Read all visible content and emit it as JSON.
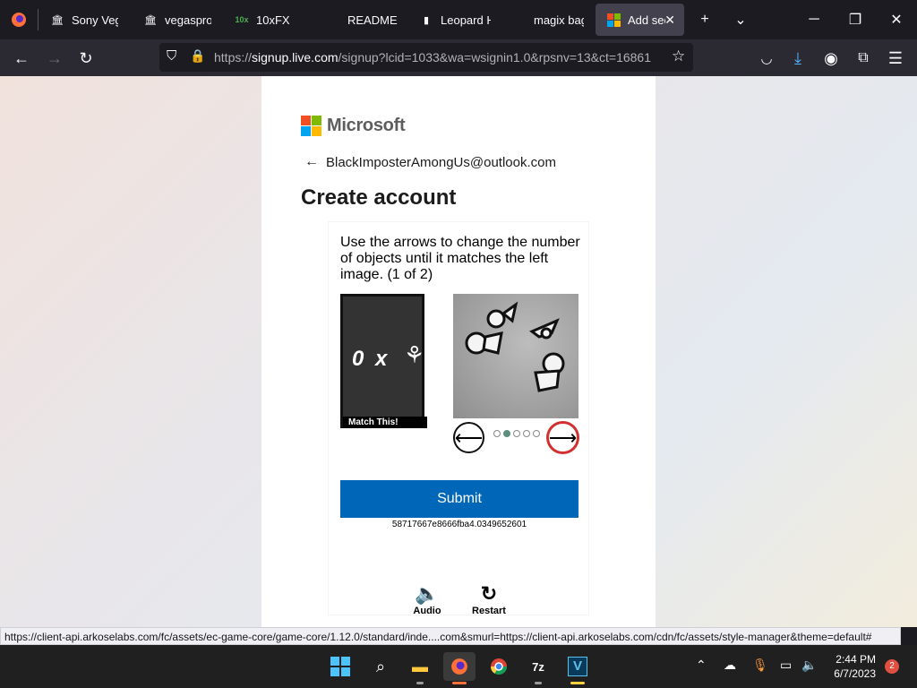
{
  "browser": {
    "tabs": [
      {
        "label": "Sony Vegas",
        "icon": "museum-icon"
      },
      {
        "label": "vegasprova",
        "icon": "museum-icon"
      },
      {
        "label": "10xFX",
        "icon": "fx-icon"
      },
      {
        "label": "README.pdf",
        "icon": "pdf-icon"
      },
      {
        "label": "Leopard H",
        "icon": "bookmark-icon"
      },
      {
        "label": "magix bagix.m",
        "icon": "page-icon"
      },
      {
        "label": "Add sec",
        "icon": "microsoft-icon",
        "active": true
      }
    ],
    "url_domain": "signup.live.com",
    "url_prefix": "https://",
    "url_rest": "/signup?lcid=1033&wa=wsignin1.0&rpsnv=13&ct=16861"
  },
  "page": {
    "brand": "Microsoft",
    "identity": "BlackImposterAmongUs@outlook.com",
    "title": "Create account",
    "challenge": {
      "instruction": "Use the arrows to change the number of objects until it matches the left image. (1 of 2)",
      "target_count": "0 x",
      "match_label": "Match This!",
      "prev_label": "⟵",
      "next_label": "⟶",
      "dots_total": 5,
      "dots_selected": 2,
      "submit_label": "Submit",
      "session_id": "58717667e8666fba4.0349652601",
      "audio_label": "Audio",
      "restart_label": "Restart"
    }
  },
  "status_url": "https://client-api.arkoselabs.com/fc/assets/ec-game-core/game-core/1.12.0/standard/inde....com&smurl=https://client-api.arkoselabs.com/cdn/fc/assets/style-manager&theme=default#",
  "taskbar": {
    "time": "2:44 PM",
    "date": "6/7/2023",
    "notification_count": "2"
  },
  "colors": {
    "accent": "#0067b8",
    "ms_red": "#f25022",
    "ms_green": "#7fba00",
    "ms_blue": "#00a4ef",
    "ms_yellow": "#ffb900"
  }
}
